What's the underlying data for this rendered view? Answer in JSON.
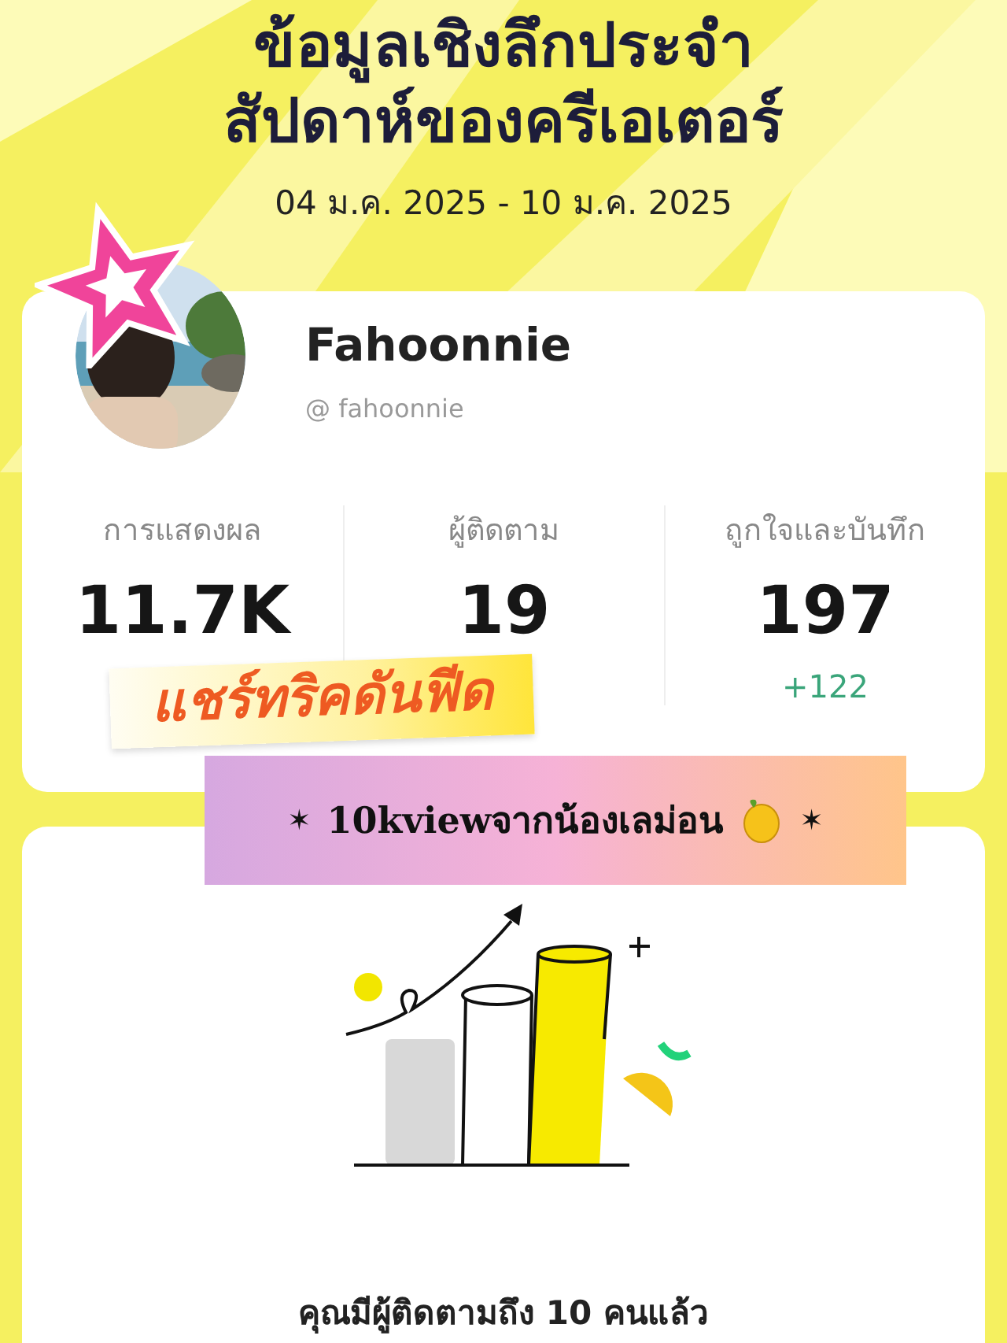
{
  "header": {
    "title_lines": [
      "ข้อมูลเชิงลึกประจำ",
      "สัปดาห์ของครีเอเตอร์"
    ],
    "date_range": "04 ม.ค. 2025 - 10 ม.ค. 2025"
  },
  "profile": {
    "name": "Fahoonnie",
    "handle": "@ fahoonnie"
  },
  "stats": [
    {
      "label": "การแสดงผล",
      "value": "11.7K"
    },
    {
      "label": "ผู้ติดตาม",
      "value": "19"
    },
    {
      "label": "ถูกใจและบันทึก",
      "value": "197",
      "change": "+122"
    }
  ],
  "stickers": [
    {
      "kind": "tape",
      "text": "แชร์ทริคดันฟีด"
    },
    {
      "kind": "banner",
      "lead": "✶",
      "text": "10kviewจากน้องเลม่อน",
      "trail": "✶"
    }
  ],
  "milestone": {
    "message": "คุณมีผู้ติดตามถึง 10 คนแล้ว"
  }
}
